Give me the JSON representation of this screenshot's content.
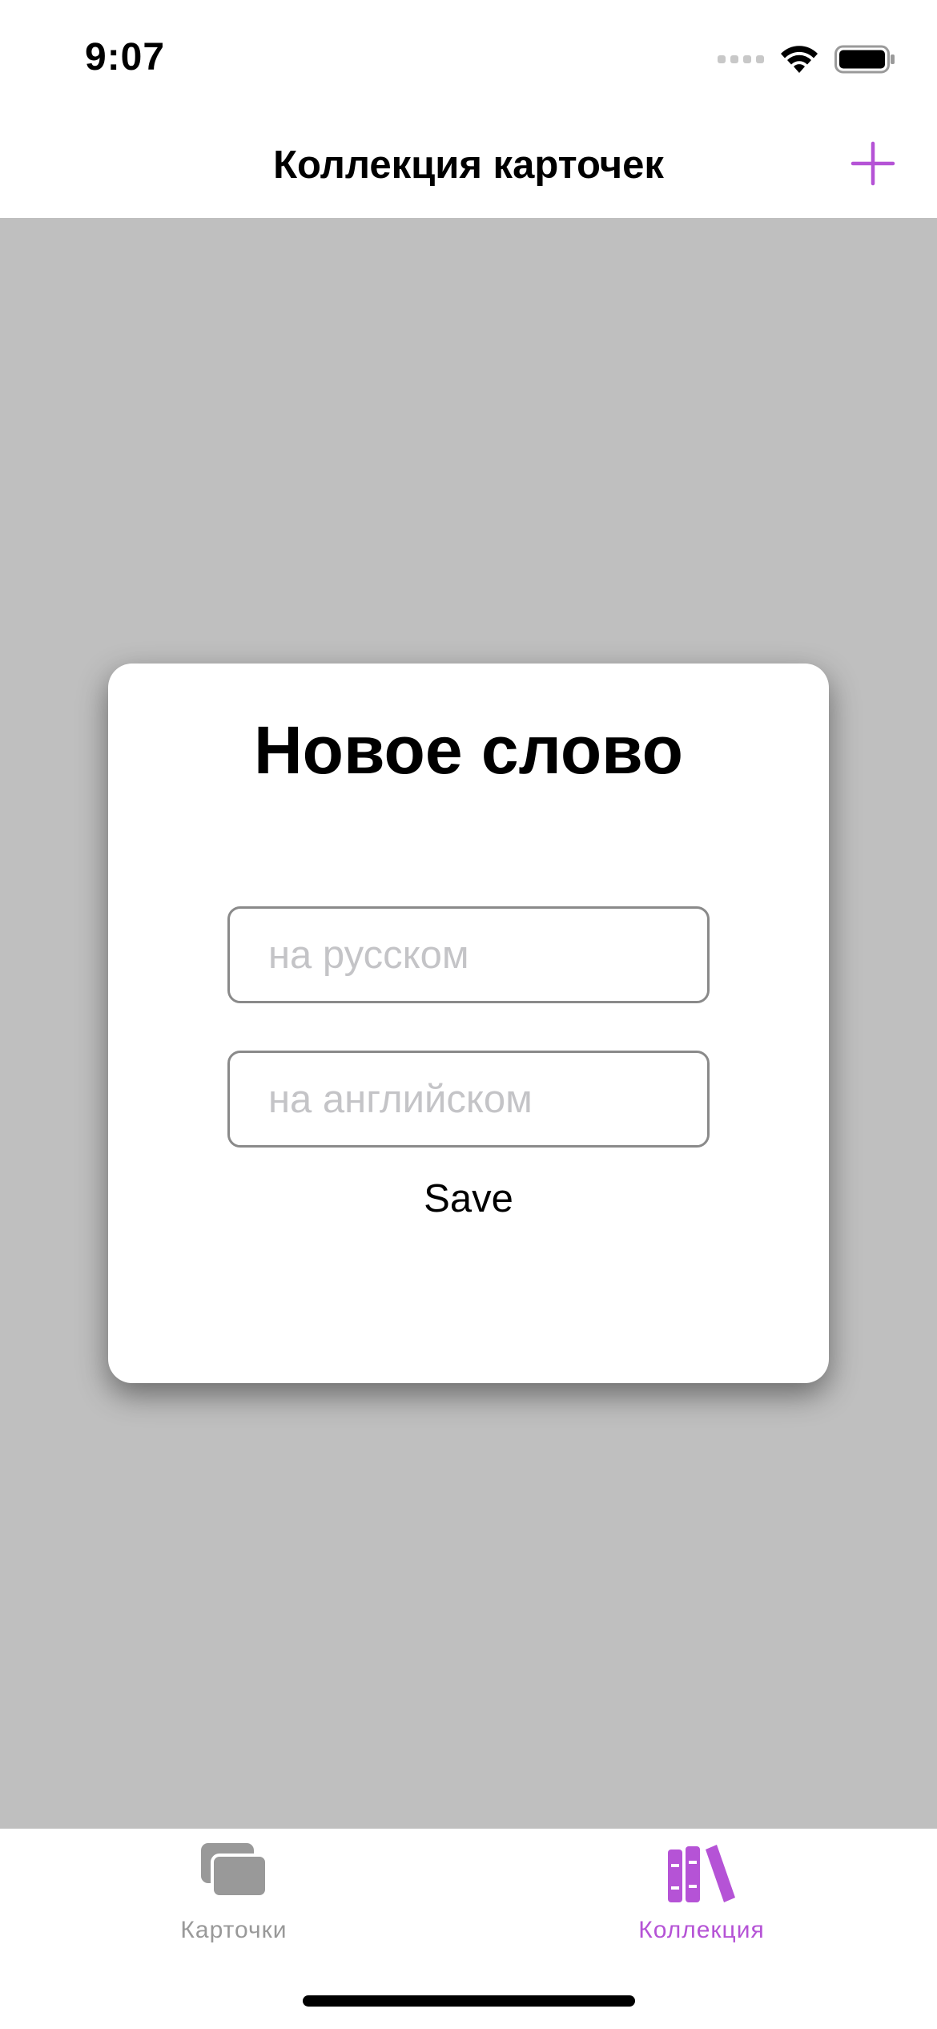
{
  "status_bar": {
    "time": "9:07",
    "icons": [
      "signal-dots-icon",
      "wifi-icon",
      "battery-icon"
    ]
  },
  "nav": {
    "title": "Коллекция карточек",
    "add_icon": "plus-icon",
    "accent_color": "#b553d6"
  },
  "modal": {
    "title": "Новое слово",
    "russian_field": {
      "value": "",
      "placeholder": "на русском"
    },
    "english_field": {
      "value": "",
      "placeholder": "на английском"
    },
    "save_label": "Save"
  },
  "tab_bar": {
    "tabs": [
      {
        "label": "Карточки",
        "icon": "cards-stack-icon",
        "selected": false
      },
      {
        "label": "Коллекция",
        "icon": "books-icon",
        "selected": true
      }
    ],
    "selected_color": "#b553d6",
    "unselected_color": "#999999"
  },
  "colors": {
    "overlay": "#bfbfbf",
    "background": "#ffffff"
  }
}
